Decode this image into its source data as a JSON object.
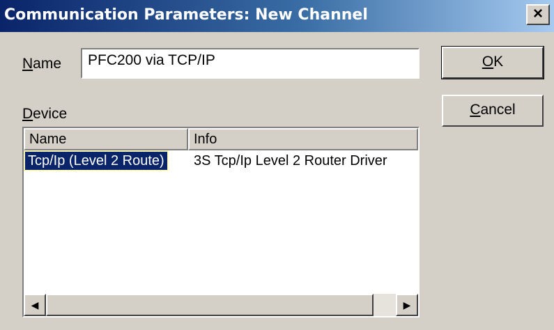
{
  "window": {
    "title": "Communication Parameters: New Channel",
    "close_glyph": "×"
  },
  "name_field": {
    "label_accel": "N",
    "label_rest": "ame",
    "value": "PFC200 via TCP/IP"
  },
  "device": {
    "label_accel": "D",
    "label_rest": "evice",
    "columns": [
      "Name",
      "Info"
    ],
    "rows": [
      {
        "name": "Tcp/Ip (Level 2 Route)",
        "info": "3S Tcp/Ip Level 2 Router Driver",
        "selected": true
      }
    ]
  },
  "buttons": {
    "ok_accel": "O",
    "ok_rest": "K",
    "cancel_accel": "C",
    "cancel_rest": "ancel"
  },
  "scrollbar": {
    "left_icon": "left-arrow-icon",
    "right_icon": "right-arrow-icon",
    "left_glyph": "◀",
    "right_glyph": "▶"
  },
  "colors": {
    "title_bar_start": "#0a246a",
    "title_bar_end": "#a6caf0",
    "selection": "#0a246a",
    "face": "#d4d0c8"
  }
}
